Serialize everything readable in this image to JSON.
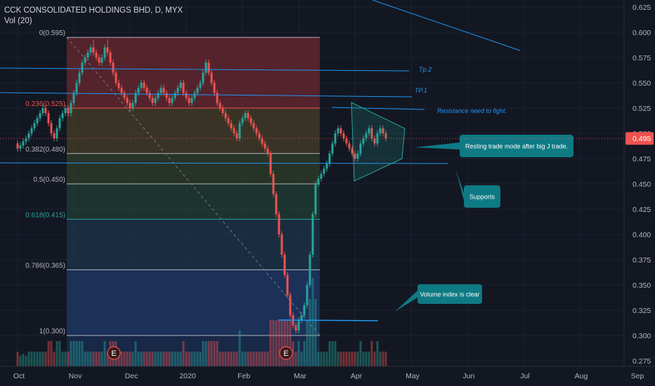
{
  "header": {
    "symbol_line": "CCK CONSOLIDATED HOLDINGS BHD, D, MYX",
    "volume_label": "Vol (20)"
  },
  "chart_data": {
    "type": "candlestick",
    "title": "CCK CONSOLIDATED HOLDINGS BHD, D, MYX",
    "price_axis": {
      "ylim": [
        0.27,
        0.63
      ],
      "ticks": [
        "0.625",
        "0.600",
        "0.575",
        "0.550",
        "0.525",
        "0.500",
        "0.475",
        "0.450",
        "0.425",
        "0.400",
        "0.375",
        "0.350",
        "0.325",
        "0.300",
        "0.275"
      ],
      "tick_values": [
        0.625,
        0.6,
        0.575,
        0.55,
        0.525,
        0.5,
        0.475,
        0.45,
        0.425,
        0.4,
        0.375,
        0.35,
        0.325,
        0.3,
        0.275
      ],
      "last_price": "0.495",
      "last_price_color": "#ef5350"
    },
    "time_axis": {
      "labels": [
        "Oct",
        "Nov",
        "Dec",
        "2020",
        "Feb",
        "Mar",
        "Apr",
        "May",
        "Jun",
        "Jul",
        "Aug",
        "Sep"
      ],
      "label_months": [
        0,
        1,
        2,
        3,
        4,
        5,
        6,
        7,
        8,
        9,
        10,
        11
      ],
      "month_origin": "2019-10"
    },
    "fibonacci": {
      "levels": [
        {
          "label": "0(0.595)",
          "value": 0.595,
          "color": "#b2b5be",
          "zone_color": "#8b2e35"
        },
        {
          "label": "0.236(0.525)",
          "value": 0.525,
          "color": "#ef5350",
          "zone_color": "#5a4a2a"
        },
        {
          "label": "0.382(0.480)",
          "value": 0.48,
          "color": "#b2b5be",
          "zone_color": "#3a4a2c"
        },
        {
          "label": "0.5(0.450)",
          "value": 0.45,
          "color": "#b2b5be",
          "zone_color": "#274a3c"
        },
        {
          "label": "0.618(0.415)",
          "value": 0.415,
          "color": "#26a69a",
          "zone_color": "#203f5a"
        },
        {
          "label": "0.786(0.365)",
          "value": 0.365,
          "color": "#b2b5be",
          "zone_color": "#1f3966"
        },
        {
          "label": "1(0.300)",
          "value": 0.3,
          "color": "#b2b5be",
          "zone_color": null
        }
      ],
      "start_month": 1.0,
      "end_month": 5.0
    },
    "annotations": {
      "text_labels": [
        {
          "text": "Tp.2",
          "color": "#2196f3"
        },
        {
          "text": "TP.1",
          "color": "#2196f3"
        },
        {
          "text": "Resistance need to fight.",
          "color": "#2196f3"
        }
      ],
      "callouts": [
        {
          "text": "Resting trade mode after big J trade."
        },
        {
          "text": "Supports"
        },
        {
          "text": "Volume index is clear"
        }
      ],
      "earnings_marker": "E",
      "colors": {
        "callout_bg": "#0e7a84",
        "line": "#2196f3",
        "up": "#26a69a",
        "down": "#ef5350"
      }
    },
    "series": [
      {
        "name": "OHLC",
        "month": [
          0.0,
          0.05,
          0.1,
          0.15,
          0.2,
          0.25,
          0.3,
          0.35,
          0.4,
          0.45,
          0.5,
          0.55,
          0.6,
          0.65,
          0.7,
          0.75,
          0.8,
          0.85,
          0.9,
          0.95,
          1.0,
          1.05,
          1.1,
          1.15,
          1.2,
          1.25,
          1.3,
          1.35,
          1.4,
          1.45,
          1.5,
          1.55,
          1.6,
          1.65,
          1.7,
          1.75,
          1.8,
          1.85,
          1.9,
          1.95,
          2.0,
          2.05,
          2.1,
          2.15,
          2.2,
          2.25,
          2.3,
          2.35,
          2.4,
          2.45,
          2.5,
          2.55,
          2.6,
          2.65,
          2.7,
          2.75,
          2.8,
          2.85,
          2.9,
          2.95,
          3.0,
          3.05,
          3.1,
          3.15,
          3.2,
          3.25,
          3.3,
          3.35,
          3.4,
          3.45,
          3.5,
          3.55,
          3.6,
          3.65,
          3.7,
          3.75,
          3.8,
          3.85,
          3.9,
          3.95,
          4.0,
          4.05,
          4.1,
          4.15,
          4.2,
          4.25,
          4.3,
          4.35,
          4.4,
          4.45,
          4.5,
          4.55,
          4.6,
          4.65,
          4.7,
          4.75,
          4.8,
          4.85,
          4.9,
          4.95,
          5.0,
          5.05,
          5.1,
          5.15,
          5.2,
          5.25,
          5.3,
          5.35,
          5.4,
          5.45,
          5.5,
          5.55,
          5.6,
          5.65,
          5.7,
          5.75,
          5.8,
          5.85,
          5.9,
          5.95,
          6.0,
          6.05,
          6.1,
          6.15,
          6.2,
          6.25,
          6.3,
          6.35,
          6.4,
          6.45,
          6.5,
          6.55
        ],
        "open": [
          0.49,
          0.485,
          0.488,
          0.492,
          0.495,
          0.5,
          0.505,
          0.51,
          0.515,
          0.52,
          0.525,
          0.52,
          0.51,
          0.5,
          0.495,
          0.505,
          0.515,
          0.52,
          0.525,
          0.52,
          0.53,
          0.54,
          0.55,
          0.56,
          0.57,
          0.575,
          0.58,
          0.585,
          0.58,
          0.575,
          0.57,
          0.575,
          0.585,
          0.58,
          0.57,
          0.56,
          0.55,
          0.545,
          0.54,
          0.535,
          0.53,
          0.525,
          0.53,
          0.54,
          0.545,
          0.55,
          0.545,
          0.54,
          0.535,
          0.53,
          0.535,
          0.54,
          0.545,
          0.54,
          0.535,
          0.53,
          0.535,
          0.54,
          0.545,
          0.55,
          0.54,
          0.535,
          0.53,
          0.535,
          0.54,
          0.545,
          0.55,
          0.56,
          0.57,
          0.56,
          0.55,
          0.54,
          0.53,
          0.525,
          0.52,
          0.515,
          0.51,
          0.505,
          0.5,
          0.495,
          0.51,
          0.515,
          0.52,
          0.515,
          0.51,
          0.505,
          0.5,
          0.495,
          0.49,
          0.485,
          0.48,
          0.46,
          0.44,
          0.42,
          0.4,
          0.38,
          0.36,
          0.34,
          0.32,
          0.31,
          0.305,
          0.315,
          0.32,
          0.33,
          0.35,
          0.38,
          0.42,
          0.45,
          0.455,
          0.46,
          0.465,
          0.47,
          0.48,
          0.49,
          0.5,
          0.505,
          0.5,
          0.495,
          0.49,
          0.485,
          0.48,
          0.475,
          0.48,
          0.49,
          0.495,
          0.5,
          0.505,
          0.495,
          0.49,
          0.5,
          0.505,
          0.5
        ],
        "close": [
          0.485,
          0.488,
          0.492,
          0.495,
          0.5,
          0.505,
          0.51,
          0.515,
          0.52,
          0.525,
          0.52,
          0.51,
          0.5,
          0.495,
          0.505,
          0.515,
          0.52,
          0.525,
          0.52,
          0.53,
          0.54,
          0.55,
          0.56,
          0.57,
          0.575,
          0.58,
          0.585,
          0.58,
          0.575,
          0.57,
          0.575,
          0.585,
          0.58,
          0.57,
          0.56,
          0.55,
          0.545,
          0.54,
          0.535,
          0.53,
          0.525,
          0.53,
          0.54,
          0.545,
          0.55,
          0.545,
          0.54,
          0.535,
          0.53,
          0.535,
          0.54,
          0.545,
          0.54,
          0.535,
          0.53,
          0.535,
          0.54,
          0.545,
          0.55,
          0.54,
          0.535,
          0.53,
          0.535,
          0.54,
          0.545,
          0.55,
          0.56,
          0.57,
          0.56,
          0.55,
          0.54,
          0.53,
          0.525,
          0.52,
          0.515,
          0.51,
          0.505,
          0.5,
          0.495,
          0.51,
          0.515,
          0.52,
          0.515,
          0.51,
          0.505,
          0.5,
          0.495,
          0.49,
          0.485,
          0.48,
          0.46,
          0.44,
          0.42,
          0.4,
          0.38,
          0.36,
          0.34,
          0.32,
          0.31,
          0.305,
          0.315,
          0.32,
          0.33,
          0.35,
          0.38,
          0.42,
          0.45,
          0.455,
          0.46,
          0.465,
          0.47,
          0.48,
          0.49,
          0.5,
          0.505,
          0.5,
          0.495,
          0.49,
          0.485,
          0.48,
          0.475,
          0.48,
          0.49,
          0.495,
          0.5,
          0.505,
          0.495,
          0.49,
          0.5,
          0.505,
          0.5,
          0.495
        ],
        "high": [
          0.493,
          0.491,
          0.495,
          0.498,
          0.503,
          0.508,
          0.513,
          0.518,
          0.523,
          0.528,
          0.528,
          0.523,
          0.513,
          0.503,
          0.508,
          0.518,
          0.523,
          0.528,
          0.528,
          0.533,
          0.543,
          0.553,
          0.563,
          0.573,
          0.578,
          0.583,
          0.588,
          0.593,
          0.583,
          0.578,
          0.578,
          0.588,
          0.593,
          0.583,
          0.573,
          0.563,
          0.553,
          0.548,
          0.543,
          0.538,
          0.533,
          0.533,
          0.543,
          0.548,
          0.553,
          0.553,
          0.548,
          0.543,
          0.538,
          0.538,
          0.543,
          0.548,
          0.548,
          0.543,
          0.538,
          0.538,
          0.543,
          0.548,
          0.553,
          0.553,
          0.543,
          0.538,
          0.538,
          0.543,
          0.548,
          0.553,
          0.563,
          0.573,
          0.573,
          0.563,
          0.553,
          0.543,
          0.533,
          0.528,
          0.523,
          0.518,
          0.513,
          0.508,
          0.503,
          0.513,
          0.518,
          0.523,
          0.523,
          0.518,
          0.513,
          0.508,
          0.503,
          0.498,
          0.493,
          0.488,
          0.483,
          0.463,
          0.443,
          0.423,
          0.403,
          0.383,
          0.363,
          0.343,
          0.323,
          0.313,
          0.318,
          0.323,
          0.333,
          0.353,
          0.383,
          0.423,
          0.453,
          0.458,
          0.463,
          0.468,
          0.473,
          0.483,
          0.493,
          0.503,
          0.508,
          0.508,
          0.503,
          0.498,
          0.493,
          0.488,
          0.483,
          0.483,
          0.493,
          0.498,
          0.503,
          0.508,
          0.508,
          0.498,
          0.503,
          0.508,
          0.508,
          0.503
        ],
        "low": [
          0.482,
          0.482,
          0.485,
          0.489,
          0.492,
          0.497,
          0.502,
          0.507,
          0.512,
          0.517,
          0.517,
          0.507,
          0.497,
          0.492,
          0.492,
          0.502,
          0.512,
          0.517,
          0.517,
          0.517,
          0.527,
          0.537,
          0.547,
          0.557,
          0.567,
          0.572,
          0.577,
          0.577,
          0.572,
          0.567,
          0.567,
          0.572,
          0.577,
          0.567,
          0.557,
          0.547,
          0.542,
          0.537,
          0.532,
          0.527,
          0.522,
          0.522,
          0.527,
          0.537,
          0.542,
          0.542,
          0.537,
          0.532,
          0.527,
          0.527,
          0.532,
          0.537,
          0.537,
          0.532,
          0.527,
          0.527,
          0.532,
          0.537,
          0.542,
          0.537,
          0.532,
          0.527,
          0.527,
          0.532,
          0.537,
          0.542,
          0.547,
          0.557,
          0.557,
          0.547,
          0.537,
          0.527,
          0.522,
          0.517,
          0.512,
          0.507,
          0.502,
          0.497,
          0.492,
          0.492,
          0.507,
          0.512,
          0.512,
          0.507,
          0.502,
          0.497,
          0.492,
          0.487,
          0.482,
          0.477,
          0.457,
          0.437,
          0.417,
          0.397,
          0.377,
          0.357,
          0.337,
          0.317,
          0.307,
          0.302,
          0.302,
          0.312,
          0.317,
          0.327,
          0.347,
          0.377,
          0.417,
          0.447,
          0.452,
          0.457,
          0.462,
          0.467,
          0.477,
          0.487,
          0.497,
          0.497,
          0.492,
          0.487,
          0.482,
          0.477,
          0.472,
          0.472,
          0.477,
          0.487,
          0.492,
          0.497,
          0.492,
          0.487,
          0.487,
          0.497,
          0.497,
          0.492
        ]
      }
    ]
  }
}
